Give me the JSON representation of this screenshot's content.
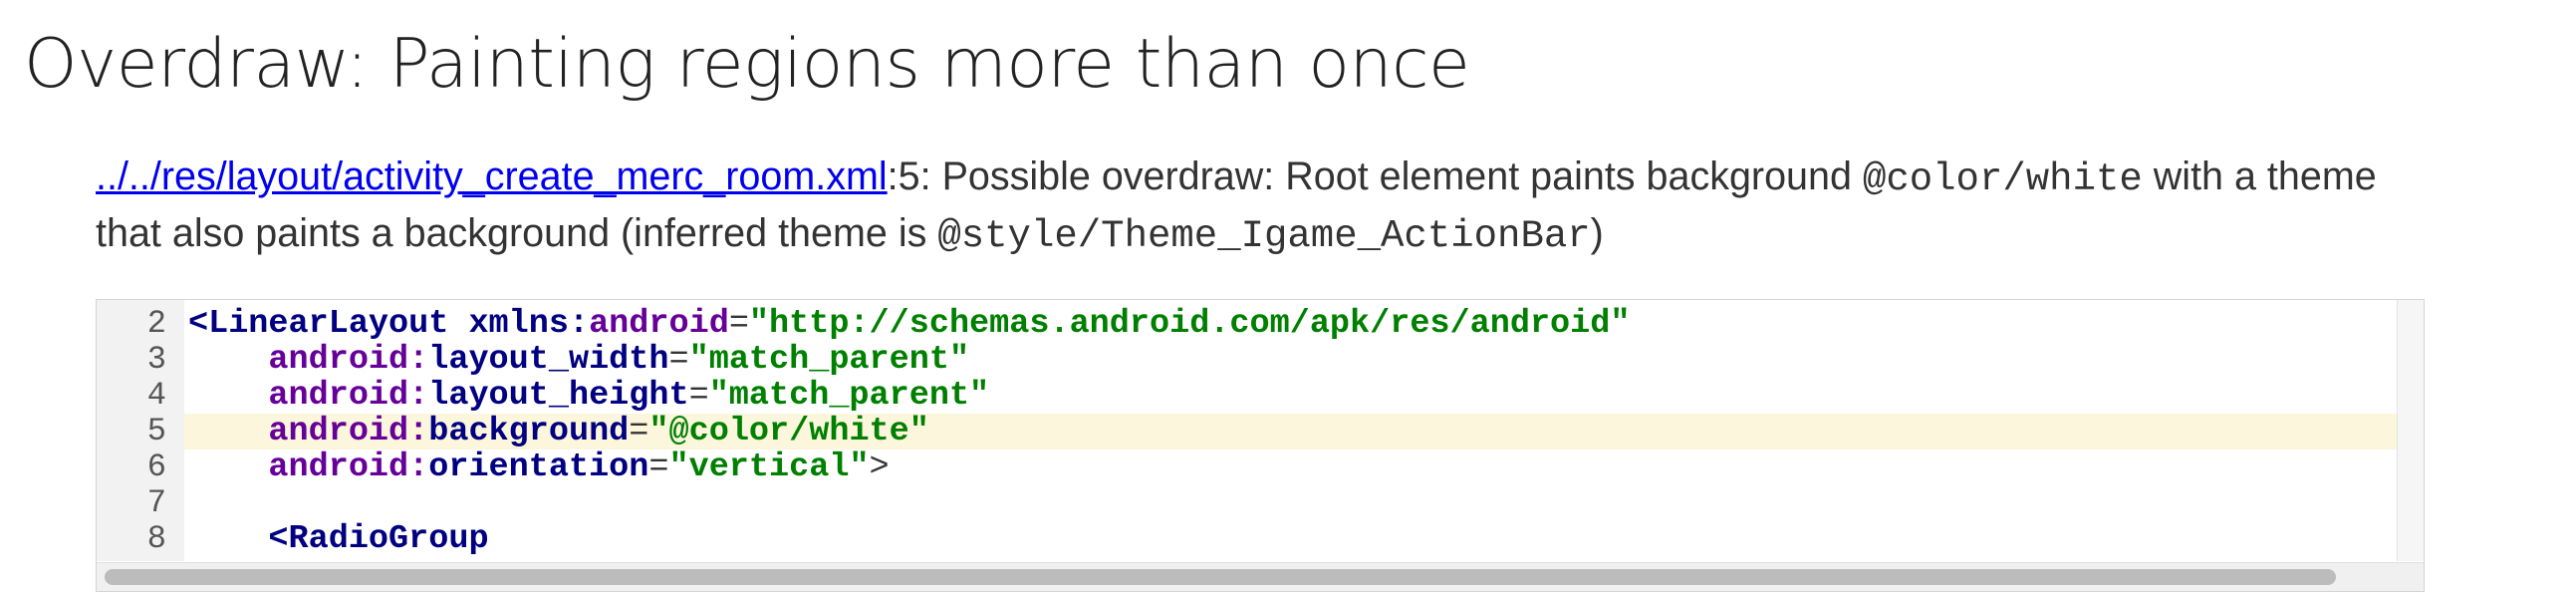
{
  "page": {
    "title": "Overdraw: Painting regions more than once"
  },
  "issue": {
    "file_link": "../../res/layout/activity_create_merc_room.xml",
    "line_ref": ":5: ",
    "msg_part1": "Possible overdraw: Root element paints background ",
    "code1": "@color/white",
    "msg_part2": " with a theme that also paints a background (inferred theme is ",
    "code2": "@style/Theme_Igame_ActionBar",
    "msg_part3": ")"
  },
  "code": {
    "highlighted_line": 5,
    "lines": [
      {
        "num": "2",
        "tokens": [
          {
            "t": "<LinearLayout",
            "c": "tag"
          },
          {
            "t": " ",
            "c": "pun"
          },
          {
            "t": "xmlns:",
            "c": "tag"
          },
          {
            "t": "android",
            "c": "attr"
          },
          {
            "t": "=",
            "c": "pun"
          },
          {
            "t": "\"http://schemas.android.com/apk/res/android\"",
            "c": "val"
          }
        ]
      },
      {
        "num": "3",
        "tokens": [
          {
            "t": "    android:",
            "c": "attr"
          },
          {
            "t": "layout_width",
            "c": "tag"
          },
          {
            "t": "=",
            "c": "pun"
          },
          {
            "t": "\"match_parent\"",
            "c": "val"
          }
        ]
      },
      {
        "num": "4",
        "tokens": [
          {
            "t": "    android:",
            "c": "attr"
          },
          {
            "t": "layout_height",
            "c": "tag"
          },
          {
            "t": "=",
            "c": "pun"
          },
          {
            "t": "\"match_parent\"",
            "c": "val"
          }
        ]
      },
      {
        "num": "5",
        "tokens": [
          {
            "t": "    android:",
            "c": "attr"
          },
          {
            "t": "background",
            "c": "tag"
          },
          {
            "t": "=",
            "c": "pun"
          },
          {
            "t": "\"@color/white\"",
            "c": "val"
          }
        ]
      },
      {
        "num": "6",
        "tokens": [
          {
            "t": "    android:",
            "c": "attr"
          },
          {
            "t": "orientation",
            "c": "tag"
          },
          {
            "t": "=",
            "c": "pun"
          },
          {
            "t": "\"vertical\"",
            "c": "val"
          },
          {
            "t": ">",
            "c": "pun"
          }
        ]
      },
      {
        "num": "7",
        "tokens": []
      },
      {
        "num": "8",
        "tokens": [
          {
            "t": "    <RadioGroup",
            "c": "tag"
          }
        ]
      }
    ]
  },
  "colors": {
    "link": "#0000ee",
    "highlight": "#fcf6dd",
    "tag": "#000080",
    "attr": "#660099",
    "value": "#008000"
  },
  "icons": {
    "scrollbar": "horizontal-scrollbar"
  }
}
